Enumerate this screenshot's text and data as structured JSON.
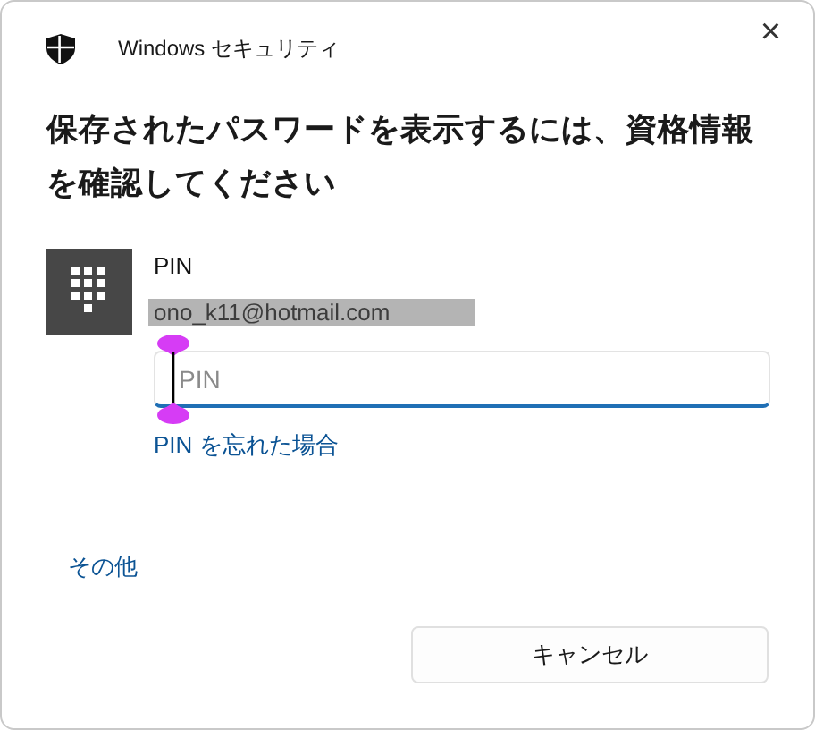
{
  "window": {
    "title": "Windows セキュリティ",
    "close": "×"
  },
  "heading": "保存されたパスワードを表示するには、資格情報を確認してください",
  "account": {
    "method": "PIN",
    "email": "ono_k11@hotmail.com"
  },
  "pin_field": {
    "placeholder": "PIN",
    "focused": true
  },
  "forgot_link": "PIN を忘れた場合",
  "more_link": "その他",
  "buttons": [
    "キャンセル"
  ]
}
